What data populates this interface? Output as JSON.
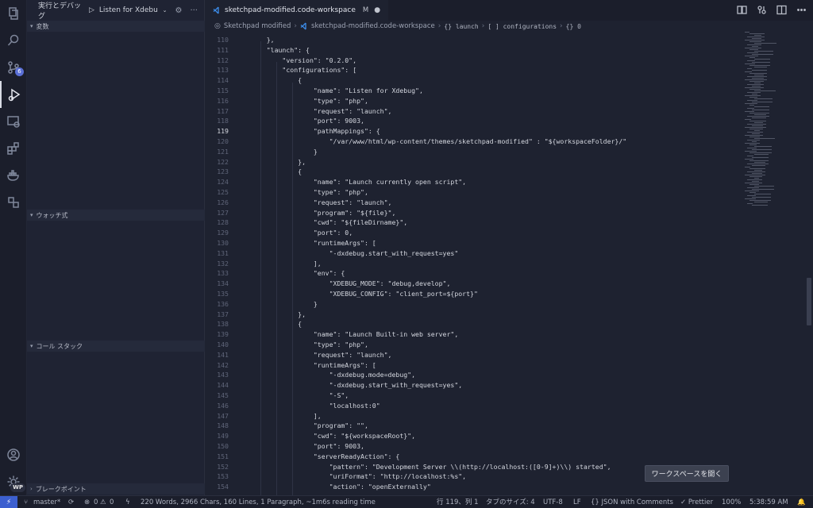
{
  "sidebar": {
    "debug_play": "▷",
    "debug_config": "Listen for Xdebug (",
    "debug_title": "実行とデバッグ",
    "sections": [
      "変数",
      "ウォッチ式",
      "コール スタック",
      "ブレークポイント"
    ]
  },
  "activity": {
    "scm_badge": "6",
    "wp_badge": "WP"
  },
  "tab": {
    "title": "sketchpad-modified.code-workspace",
    "modified": "M"
  },
  "breadcrumb": {
    "folder": "Sketchpad modified",
    "file": "sketchpad-modified.code-workspace",
    "c1": "{} launch",
    "c2": "[ ] configurations",
    "c3": "{} 0"
  },
  "editor": {
    "lines": [
      {
        "n": "110",
        "t": "    },"
      },
      {
        "n": "111",
        "t": "    \"launch\": {"
      },
      {
        "n": "112",
        "t": "        \"version\": \"0.2.0\","
      },
      {
        "n": "113",
        "t": "        \"configurations\": ["
      },
      {
        "n": "114",
        "t": "            {"
      },
      {
        "n": "115",
        "t": "                \"name\": \"Listen for Xdebug\","
      },
      {
        "n": "116",
        "t": "                \"type\": \"php\","
      },
      {
        "n": "117",
        "t": "                \"request\": \"launch\","
      },
      {
        "n": "118",
        "t": "                \"port\": 9003,"
      },
      {
        "n": "119",
        "t": "                \"pathMappings\": {"
      },
      {
        "n": "120",
        "t": "                    \"/var/www/html/wp-content/themes/sketchpad-modified\" : \"${workspaceFolder}/\""
      },
      {
        "n": "121",
        "t": "                }"
      },
      {
        "n": "122",
        "t": "            },"
      },
      {
        "n": "123",
        "t": "            {"
      },
      {
        "n": "124",
        "t": "                \"name\": \"Launch currently open script\","
      },
      {
        "n": "125",
        "t": "                \"type\": \"php\","
      },
      {
        "n": "126",
        "t": "                \"request\": \"launch\","
      },
      {
        "n": "127",
        "t": "                \"program\": \"${file}\","
      },
      {
        "n": "128",
        "t": "                \"cwd\": \"${fileDirname}\","
      },
      {
        "n": "129",
        "t": "                \"port\": 0,"
      },
      {
        "n": "130",
        "t": "                \"runtimeArgs\": ["
      },
      {
        "n": "131",
        "t": "                    \"-dxdebug.start_with_request=yes\""
      },
      {
        "n": "132",
        "t": "                ],"
      },
      {
        "n": "133",
        "t": "                \"env\": {"
      },
      {
        "n": "134",
        "t": "                    \"XDEBUG_MODE\": \"debug,develop\","
      },
      {
        "n": "135",
        "t": "                    \"XDEBUG_CONFIG\": \"client_port=${port}\""
      },
      {
        "n": "136",
        "t": "                }"
      },
      {
        "n": "137",
        "t": "            },"
      },
      {
        "n": "138",
        "t": "            {"
      },
      {
        "n": "139",
        "t": "                \"name\": \"Launch Built-in web server\","
      },
      {
        "n": "140",
        "t": "                \"type\": \"php\","
      },
      {
        "n": "141",
        "t": "                \"request\": \"launch\","
      },
      {
        "n": "142",
        "t": "                \"runtimeArgs\": ["
      },
      {
        "n": "143",
        "t": "                    \"-dxdebug.mode=debug\","
      },
      {
        "n": "144",
        "t": "                    \"-dxdebug.start_with_request=yes\","
      },
      {
        "n": "145",
        "t": "                    \"-S\","
      },
      {
        "n": "146",
        "t": "                    \"localhost:0\""
      },
      {
        "n": "147",
        "t": "                ],"
      },
      {
        "n": "148",
        "t": "                \"program\": \"\","
      },
      {
        "n": "149",
        "t": "                \"cwd\": \"${workspaceRoot}\","
      },
      {
        "n": "150",
        "t": "                \"port\": 9003,"
      },
      {
        "n": "151",
        "t": "                \"serverReadyAction\": {"
      },
      {
        "n": "152",
        "t": "                    \"pattern\": \"Development Server \\\\(http://localhost:([0-9]+)\\\\) started\","
      },
      {
        "n": "153",
        "t": "                    \"uriFormat\": \"http://localhost:%s\","
      },
      {
        "n": "154",
        "t": "                    \"action\": \"openExternally\""
      }
    ],
    "current_line": "119"
  },
  "open_workspace_button": "ワークスペースを開く",
  "status": {
    "branch": "master*",
    "errors": "0",
    "warnings": "0",
    "stats": "220 Words, 2966 Chars, 160 Lines, 1 Paragraph, ~1m6s reading time",
    "position": "行 119、列 1",
    "tabsize": "タブのサイズ: 4",
    "encoding": "UTF-8",
    "eol": "LF",
    "language": "{} JSON with Comments",
    "prettier": "✓ Prettier",
    "zoom": "100%",
    "time": "5:38:59 AM"
  }
}
